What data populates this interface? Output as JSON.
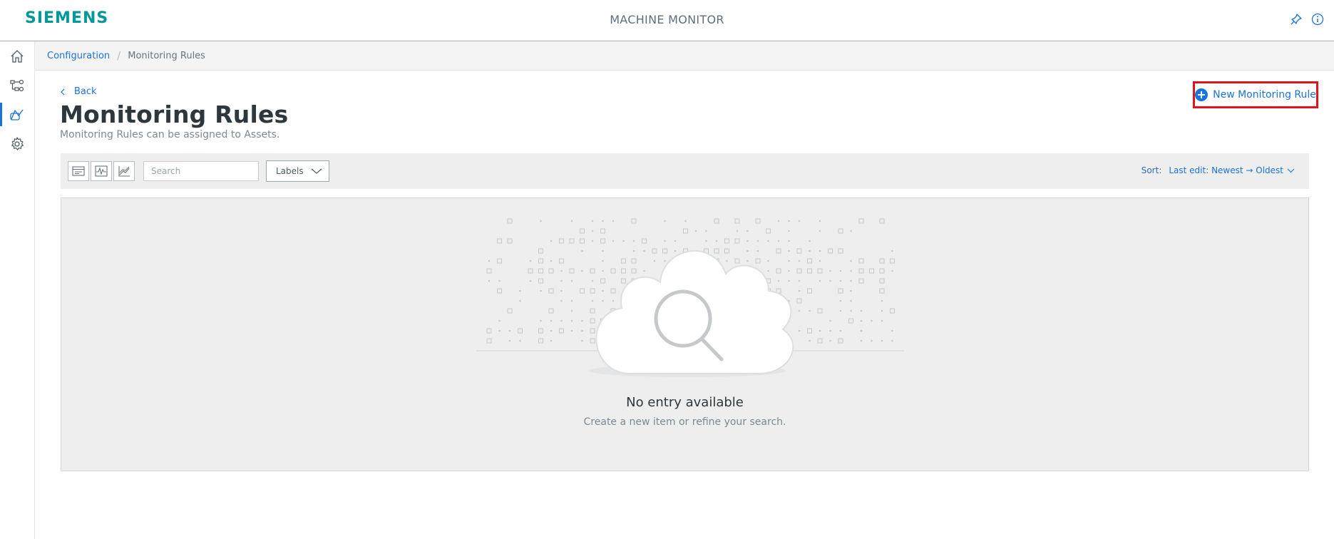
{
  "header": {
    "logo": "SIEMENS",
    "app_title": "MACHINE MONITOR",
    "icons": [
      "pin-icon",
      "info-icon"
    ]
  },
  "leftnav": {
    "items": [
      {
        "name": "home",
        "icon": "home-icon",
        "active": false
      },
      {
        "name": "assets",
        "icon": "hierarchy-icon",
        "active": false
      },
      {
        "name": "monitoring",
        "icon": "monitoring-icon",
        "active": true
      },
      {
        "name": "settings",
        "icon": "gear-icon",
        "active": false
      }
    ]
  },
  "breadcrumb": {
    "items": [
      "Configuration",
      "Monitoring Rules"
    ]
  },
  "page": {
    "back_label": "Back",
    "title": "Monitoring Rules",
    "subtitle": "Monitoring Rules can be assigned to Assets.",
    "new_button_label": "New Monitoring Rule"
  },
  "toolbar": {
    "view_toggles": [
      "card-view-icon",
      "signal-view-icon",
      "chart-view-icon"
    ],
    "search_placeholder": "Search",
    "labels_dropdown": "Labels",
    "sort_label": "Sort:",
    "sort_value": "Last edit: Newest → Oldest"
  },
  "empty_state": {
    "title": "No entry available",
    "subtitle": "Create a new item or refine your search."
  },
  "colors": {
    "brand": "#009999",
    "accent": "#1a73d9",
    "highlight_border": "#e0141f"
  }
}
